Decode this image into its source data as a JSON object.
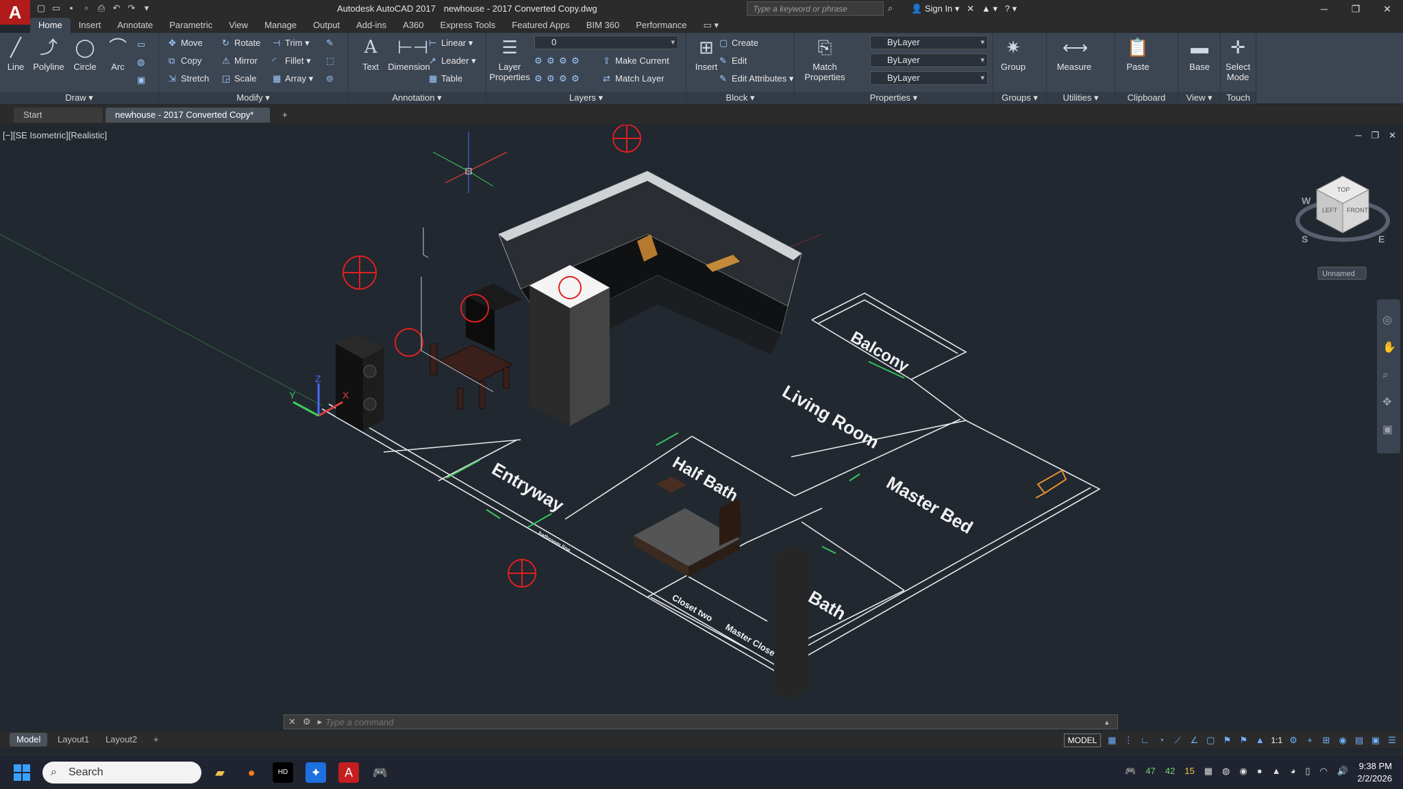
{
  "app": {
    "logo": "A",
    "title": "Autodesk AutoCAD 2017",
    "file": "newhouse - 2017 Converted Copy.dwg",
    "search_placeholder": "Type a keyword or phrase",
    "sign_in": "Sign In"
  },
  "ribbon_tabs": [
    "Home",
    "Insert",
    "Annotate",
    "Parametric",
    "View",
    "Manage",
    "Output",
    "Add-ins",
    "A360",
    "Express Tools",
    "Featured Apps",
    "BIM 360",
    "Performance"
  ],
  "panels": {
    "draw": {
      "label": "Draw",
      "line": "Line",
      "polyline": "Polyline",
      "circle": "Circle",
      "arc": "Arc"
    },
    "modify": {
      "label": "Modify",
      "move": "Move",
      "rotate": "Rotate",
      "trim": "Trim",
      "copy": "Copy",
      "mirror": "Mirror",
      "fillet": "Fillet",
      "stretch": "Stretch",
      "scale": "Scale",
      "array": "Array"
    },
    "annotation": {
      "label": "Annotation",
      "text": "Text",
      "dimension": "Dimension",
      "linear": "Linear",
      "leader": "Leader",
      "table": "Table"
    },
    "layers": {
      "label": "Layers",
      "layer_properties": "Layer Properties",
      "current_layer": "0",
      "make_current": "Make Current",
      "match_layer": "Match Layer"
    },
    "block": {
      "label": "Block",
      "insert": "Insert",
      "create": "Create",
      "edit": "Edit",
      "edit_attributes": "Edit Attributes"
    },
    "properties": {
      "label": "Properties",
      "match_properties": "Match Properties",
      "color": "ByLayer",
      "linetype": "ByLayer",
      "lineweight": "ByLayer"
    },
    "groups": {
      "label": "Groups",
      "group": "Group"
    },
    "utilities": {
      "label": "Utilities",
      "measure": "Measure"
    },
    "clipboard": {
      "label": "Clipboard",
      "paste": "Paste"
    },
    "view": {
      "label": "View",
      "base": "Base"
    },
    "touch": {
      "label": "Touch",
      "select_mode": "Select Mode"
    }
  },
  "doc_tabs": {
    "start": "Start",
    "active": "newhouse - 2017 Converted Copy*"
  },
  "viewport": {
    "label": "[−][SE Isometric][Realistic]",
    "rooms": [
      "Balcony",
      "Living Room",
      "Entryway",
      "Half Bath",
      "Master Bed",
      "Bath",
      "Closet two",
      "Master Close",
      "bathroom line"
    ],
    "viewcube_top": "TOP",
    "viewcube_left": "LEFT",
    "viewcube_front": "FRONT",
    "compass_s": "S",
    "compass_e": "E",
    "compass_w": "W",
    "ucs": "Unnamed",
    "axis_x": "X",
    "axis_y": "Y",
    "axis_z": "Z"
  },
  "command": {
    "placeholder": "Type a command"
  },
  "layout_tabs": [
    "Model",
    "Layout1",
    "Layout2"
  ],
  "status": {
    "model": "MODEL",
    "scale": "1:1"
  },
  "taskbar": {
    "search": "Search",
    "tray_numbers": [
      "47",
      "42",
      "15"
    ],
    "time": "9:38 PM",
    "date": "2/2/2026"
  }
}
